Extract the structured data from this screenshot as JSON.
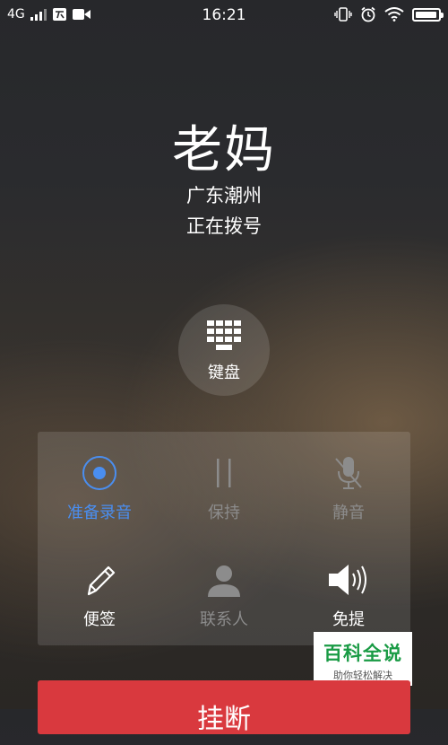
{
  "status_bar": {
    "network": "4G",
    "time": "16:21",
    "battery_level": 0.95,
    "icons": [
      "signal-icon",
      "cloud-icon",
      "video-icon",
      "vibrate-icon",
      "alarm-icon",
      "wifi-icon",
      "battery-icon"
    ]
  },
  "call": {
    "name": "老妈",
    "location": "广东潮州",
    "status": "正在拨号"
  },
  "keypad": {
    "label": "键盘",
    "icon": "dialpad-icon"
  },
  "controls": {
    "record": {
      "label": "准备录音",
      "icon": "record-icon",
      "state": "active"
    },
    "hold": {
      "label": "保持",
      "icon": "pause-icon",
      "state": "disabled"
    },
    "mute": {
      "label": "静音",
      "icon": "mic-off-icon",
      "state": "disabled"
    },
    "notes": {
      "label": "便签",
      "icon": "pencil-icon",
      "state": "enabled"
    },
    "contacts": {
      "label": "联系人",
      "icon": "person-icon",
      "state": "disabled"
    },
    "speaker": {
      "label": "免提",
      "icon": "speaker-icon",
      "state": "enabled"
    }
  },
  "hangup": {
    "label": "挂断",
    "color": "#d9393e"
  },
  "watermark": {
    "title": "百科全说",
    "subtitle": "助你轻松解决"
  },
  "colors": {
    "accent": "#4a8ef0",
    "disabled": "#8c8c8c"
  }
}
